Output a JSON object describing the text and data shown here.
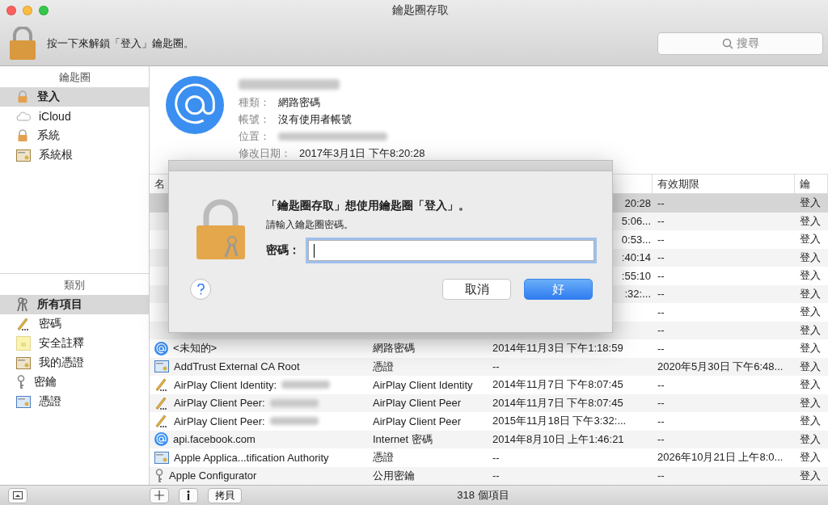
{
  "window": {
    "title": "鑰匙圈存取"
  },
  "toolbar": {
    "unlock_text": "按一下來解鎖「登入」鑰匙圈。",
    "search": {
      "placeholder": "搜尋"
    }
  },
  "sidebar": {
    "keychains": {
      "heading": "鑰匙圈",
      "items": [
        {
          "label": "登入",
          "kind": "lock",
          "selected": true
        },
        {
          "label": "iCloud",
          "kind": "cloud",
          "selected": false
        },
        {
          "label": "系統",
          "kind": "lock",
          "selected": false
        },
        {
          "label": "系統根",
          "kind": "certs",
          "selected": false
        }
      ]
    },
    "categories": {
      "heading": "類別",
      "items": [
        {
          "label": "所有項目",
          "kind": "keys",
          "selected": true
        },
        {
          "label": "密碼",
          "kind": "pencil",
          "selected": false
        },
        {
          "label": "安全註釋",
          "kind": "note",
          "selected": false
        },
        {
          "label": "我的憑證",
          "kind": "mycert",
          "selected": false
        },
        {
          "label": "密鑰",
          "kind": "key",
          "selected": false
        },
        {
          "label": "憑證",
          "kind": "cert",
          "selected": false
        }
      ]
    }
  },
  "detail": {
    "title_redacted": true,
    "fields": [
      {
        "label": "種類：",
        "value": "網路密碼",
        "redacted": false
      },
      {
        "label": "帳號：",
        "value": "沒有使用者帳號",
        "redacted": false
      },
      {
        "label": "位置：",
        "redacted": true
      },
      {
        "label": "修改日期：",
        "value": "2017年3月1日 下午8:20:28",
        "redacted": false
      }
    ]
  },
  "table": {
    "columns": {
      "name": "名",
      "expiry": "有效期限",
      "keychain": "鑰"
    },
    "rows": [
      {
        "selected": true,
        "date": "20:28",
        "expiry": "--",
        "keychain": "登入"
      },
      {
        "selected": false,
        "date": "5:06...",
        "expiry": "--",
        "keychain": "登入"
      },
      {
        "selected": false,
        "date": "0:53...",
        "expiry": "--",
        "keychain": "登入"
      },
      {
        "selected": false,
        "date": ":40:14",
        "expiry": "--",
        "keychain": "登入"
      },
      {
        "selected": false,
        "date": ":55:10",
        "expiry": "--",
        "keychain": "登入"
      },
      {
        "selected": false,
        "date": ":32:...",
        "expiry": "--",
        "keychain": "登入"
      },
      {
        "selected": false,
        "expiry": "--",
        "keychain": "登入"
      },
      {
        "selected": false,
        "expiry": "--",
        "keychain": "登入"
      },
      {
        "selected": false,
        "kind": "web",
        "name": "<未知的>",
        "item_type": "網路密碼",
        "date": "2014年11月3日 下午1:18:59",
        "expiry": "--",
        "keychain": "登入"
      },
      {
        "selected": false,
        "kind": "cert",
        "name": "AddTrust External CA Root",
        "item_type": "憑證",
        "date": "--",
        "expiry": "2020年5月30日 下午6:48...",
        "keychain": "登入"
      },
      {
        "selected": false,
        "kind": "pencil",
        "name": "AirPlay Client Identity:",
        "redacted": true,
        "item_type": "AirPlay Client Identity",
        "date": "2014年11月7日 下午8:07:45",
        "expiry": "--",
        "keychain": "登入"
      },
      {
        "selected": false,
        "kind": "pencil",
        "name": "AirPlay Client Peer:",
        "redacted": true,
        "item_type": "AirPlay Client Peer",
        "date": "2014年11月7日 下午8:07:45",
        "expiry": "--",
        "keychain": "登入"
      },
      {
        "selected": false,
        "kind": "pencil",
        "name": "AirPlay Client Peer:",
        "redacted": true,
        "item_type": "AirPlay Client Peer",
        "date": "2015年11月18日 下午3:32:...",
        "expiry": "--",
        "keychain": "登入"
      },
      {
        "selected": false,
        "kind": "web",
        "name": "api.facebook.com",
        "item_type": "Internet 密碼",
        "date": "2014年8月10日 上午1:46:21",
        "expiry": "--",
        "keychain": "登入"
      },
      {
        "selected": false,
        "kind": "cert",
        "name": "Apple Applica...tification Authority",
        "item_type": "憑證",
        "date": "--",
        "expiry": "2026年10月21日 上午8:0...",
        "keychain": "登入"
      },
      {
        "selected": false,
        "kind": "key",
        "name": "Apple Configurator",
        "item_type": "公用密鑰",
        "date": "--",
        "expiry": "--",
        "keychain": "登入"
      }
    ]
  },
  "bottom_bar": {
    "copy_button": "拷貝",
    "count": "318 個項目"
  },
  "dialog": {
    "title": "「鑰匙圈存取」想使用鑰匙圈「登入」。",
    "message": "請輸入鑰匙圈密碼。",
    "field_label": "密碼：",
    "field": {
      "focused": true
    },
    "buttons": [
      {
        "label": "取消",
        "default": false
      },
      {
        "label": "好",
        "default": true
      }
    ]
  }
}
